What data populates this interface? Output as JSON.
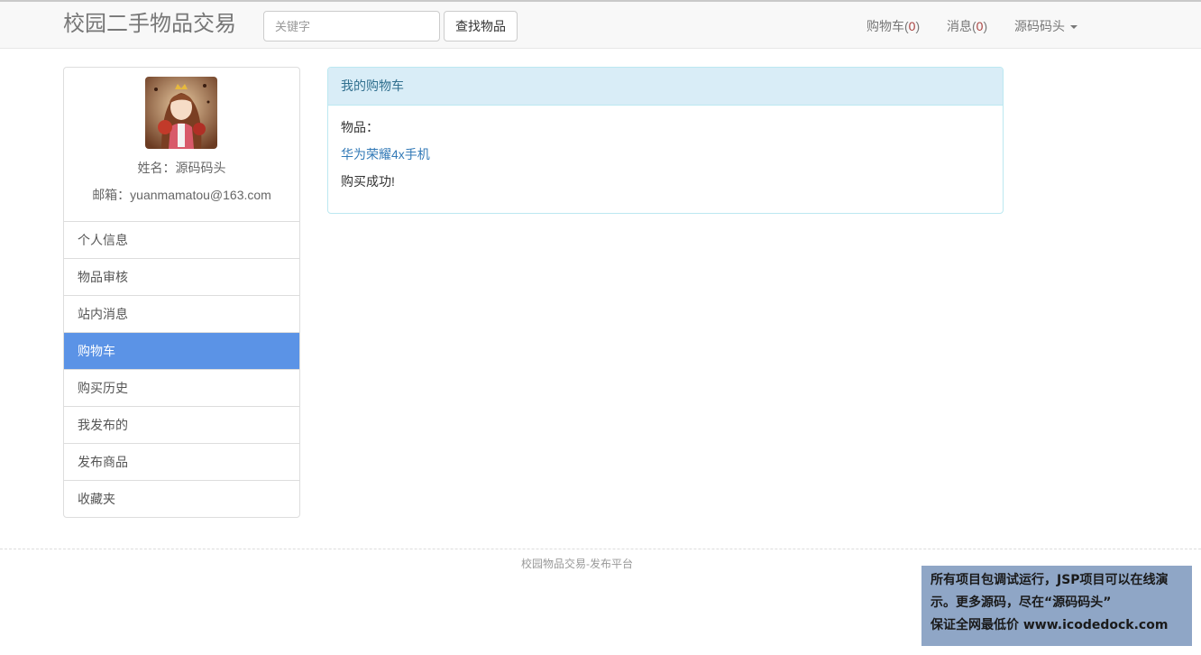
{
  "header": {
    "brand": "校园二手物品交易",
    "search_placeholder": "关键字",
    "search_button": "查找物品",
    "cart_label": "购物车(",
    "cart_count": "0",
    "messages_label": "消息(",
    "messages_count": "0",
    "paren_close": ")",
    "user_menu": "源码码头"
  },
  "profile": {
    "name_line": "姓名：源码码头",
    "email_line": "邮箱：yuanmamatou@163.com"
  },
  "sidebar": {
    "items": [
      {
        "label": "个人信息"
      },
      {
        "label": "物品审核"
      },
      {
        "label": "站内消息"
      },
      {
        "label": "购物车"
      },
      {
        "label": "购买历史"
      },
      {
        "label": "我发布的"
      },
      {
        "label": "发布商品"
      },
      {
        "label": "收藏夹"
      }
    ],
    "active": "购物车"
  },
  "cart_panel": {
    "title": "我的购物车",
    "item_label": "物品：",
    "item_name": "华为荣耀4x手机",
    "status": "购买成功!"
  },
  "footer": {
    "text": "校园物品交易-发布平台"
  },
  "promo": {
    "line1": "所有项目包调试运行，JSP项目可以在线演",
    "line2": "示。更多源码，尽在“源码码头”",
    "line3": "保证全网最低价 www.icodedock.com"
  },
  "colors": {
    "active_menu": "#5b93e6",
    "panel_heading_bg": "#d9edf7",
    "panel_heading_text": "#31708f",
    "link": "#337ab7",
    "count": "#a94442",
    "promo_bg": "#8fa6c6"
  }
}
